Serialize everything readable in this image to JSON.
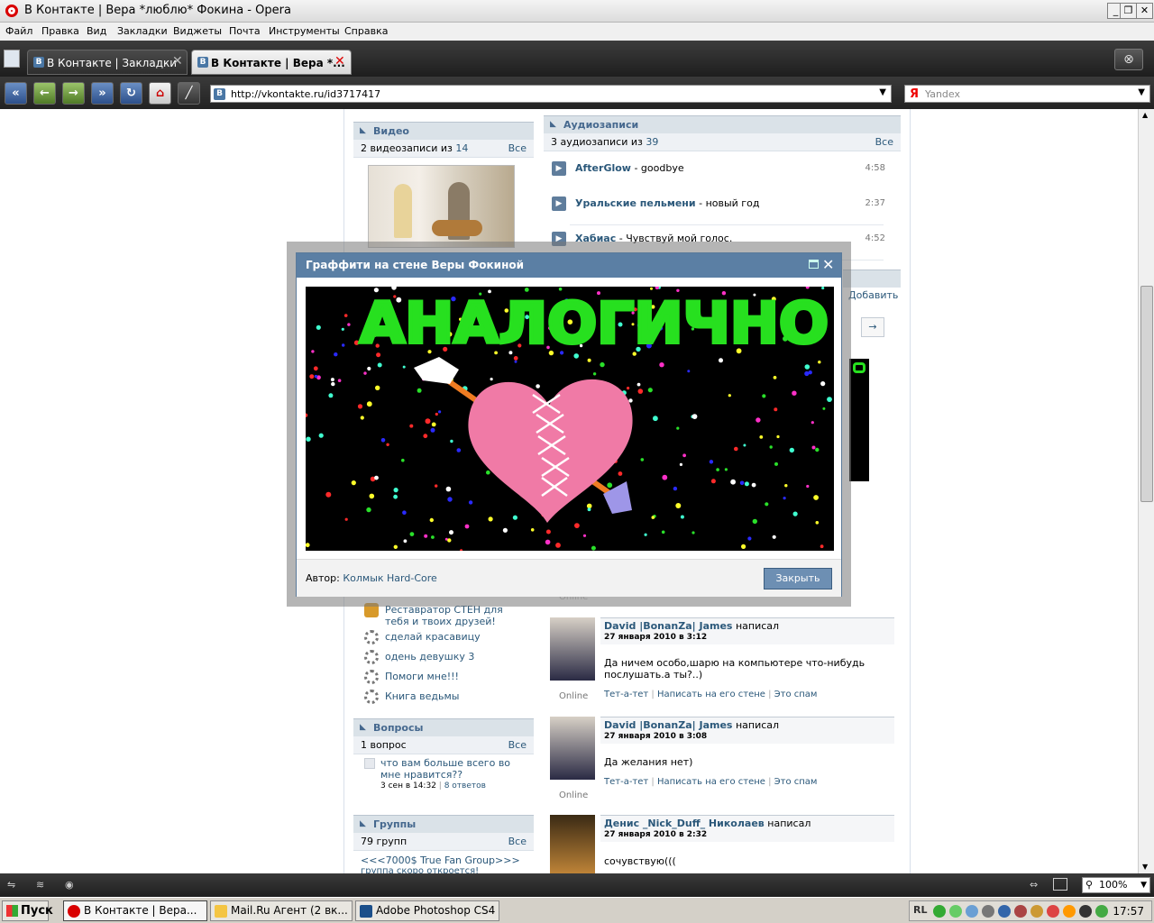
{
  "window": {
    "title": "В Контакте | Вера *люблю* Фокина - Opera"
  },
  "menu": [
    "Файл",
    "Правка",
    "Вид",
    "Закладки",
    "Виджеты",
    "Почта",
    "Инструменты",
    "Справка"
  ],
  "tabs": [
    {
      "label": "В Контакте | Закладки",
      "favicon": "B"
    },
    {
      "label": "В Контакте | Вера *...",
      "favicon": "B"
    }
  ],
  "address": {
    "url": "http://vkontakte.ru/id3717417",
    "favicon": "B"
  },
  "search": {
    "placeholder": "Yandex",
    "engine_icon": "Я"
  },
  "video": {
    "title": "Видео",
    "count_prefix": "2 видеозаписи из ",
    "count_link": "14",
    "all": "Все"
  },
  "audio": {
    "title": "Аудиозаписи",
    "count_prefix": "3 аудиозаписи из ",
    "count_link": "39",
    "all": "Все",
    "tracks": [
      {
        "artist": "AfterGlow",
        "title": " - goodbye",
        "duration": "4:58"
      },
      {
        "artist": "Уральские пельмени",
        "title": " - новый год",
        "duration": "2:37"
      },
      {
        "artist": "Хабиас",
        "title": " - Чувствуй мой голос.",
        "duration": "4:52"
      }
    ]
  },
  "wall_partial": {
    "add_link": "Добавить",
    "next_arrow": "→"
  },
  "apps": [
    {
      "label": "Реставратор СТЕН для тебя и твоих друзей!",
      "icon": "app-icon"
    },
    {
      "label": "сделай красавицу",
      "icon": "gear-icon"
    },
    {
      "label": "одень девушку 3",
      "icon": "gear-icon"
    },
    {
      "label": "Помоги мне!!!",
      "icon": "gear-icon"
    },
    {
      "label": "Книга ведьмы",
      "icon": "gear-icon"
    }
  ],
  "questions": {
    "title": "Вопросы",
    "count": "1 вопрос",
    "all": "Все",
    "item": {
      "text": "что вам больше всего во мне нравится??",
      "date": "3 сен в 14:32",
      "answers": "8 ответов"
    }
  },
  "groups": {
    "title": "Группы",
    "count": "79 групп",
    "all": "Все",
    "first": "<<<7000$ True Fan Group>>>",
    "first_sub": "группа скоро откроется!"
  },
  "online_label": "Online",
  "wall": [
    {
      "author": "David |BonanZa| James",
      "action": " написал",
      "date": "27 января 2010 в 3:12",
      "message": "Да ничем особо,шарю на компьютере что-нибудь послушать.а ты?..)",
      "links": [
        "Тет-а-тет",
        "Написать на его стене",
        "Это спам"
      ],
      "online": true
    },
    {
      "author": "David |BonanZa| James",
      "action": " написал",
      "date": "27 января 2010 в 3:08",
      "message": "Да желания нет)",
      "links": [
        "Тет-а-тет",
        "Написать на его стене",
        "Это спам"
      ],
      "online": true
    },
    {
      "author": "Денис _Nick_Duff_ Николаев",
      "action": " написал",
      "date": "27 января 2010 в 2:32",
      "message": "сочувствую(((",
      "online": false
    }
  ],
  "popup": {
    "title": "Граффити на стене Веры Фокиной",
    "graffiti_text": "АНАЛОГИЧНО",
    "author_label": "Автор: ",
    "author_name": "Колмык Hard-Core",
    "close_button": "Закрыть"
  },
  "status": {
    "zoom": "100%"
  },
  "taskbar": {
    "start": "Пуск",
    "tasks": [
      "В Контакте | Вера...",
      "Mail.Ru Агент (2 вк...",
      "Adobe Photoshop CS4"
    ],
    "lang": "RL",
    "clock": "17:57"
  },
  "colors": {
    "vk_header": "#dae2e8",
    "vk_link": "#2b587a",
    "popup_header": "#5b7fa4",
    "graffiti_text": "#27e01f",
    "heart": "#f07aa6"
  }
}
